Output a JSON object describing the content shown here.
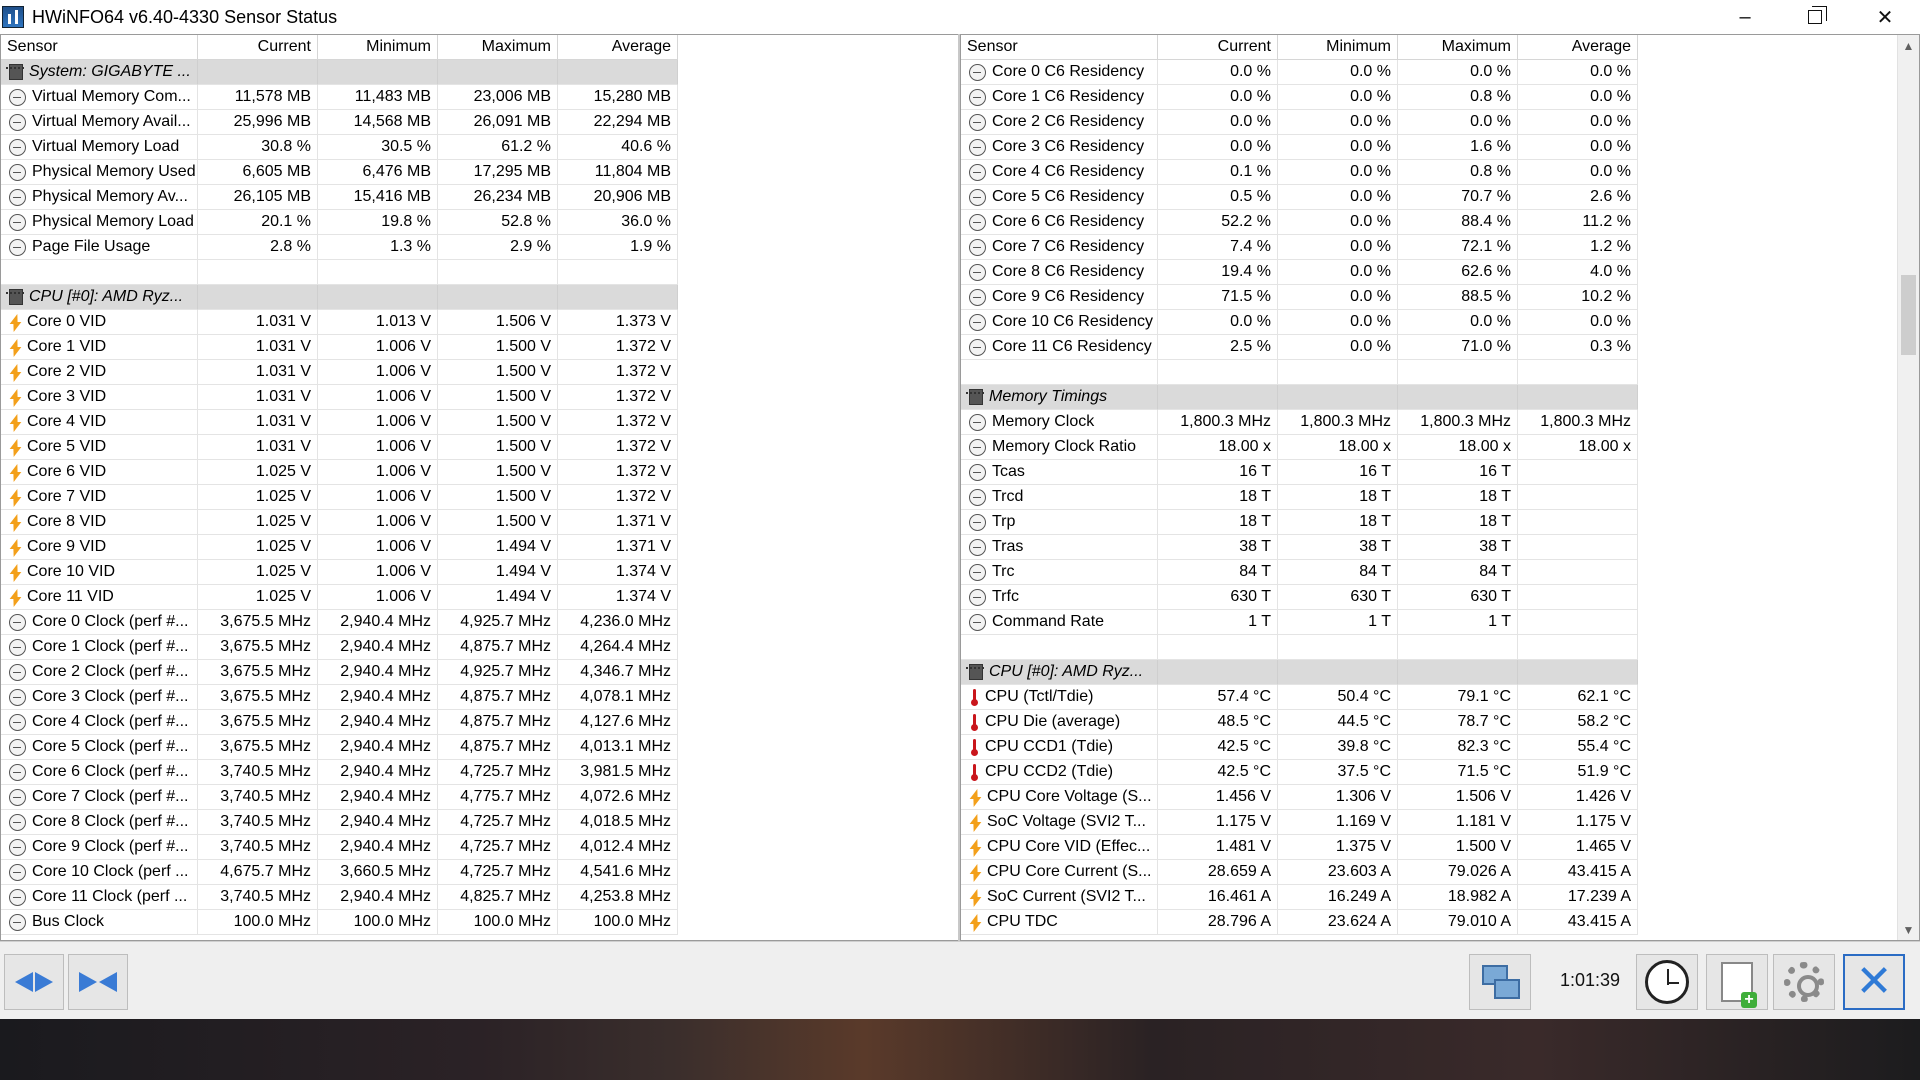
{
  "window": {
    "title": "HWiNFO64 v6.40-4330 Sensor Status",
    "controls": {
      "minimize": "–",
      "close": "✕"
    }
  },
  "columns": [
    "Sensor",
    "Current",
    "Minimum",
    "Maximum",
    "Average"
  ],
  "left_rows": [
    {
      "type": "group",
      "name": "System: GIGABYTE ..."
    },
    {
      "icon": "clock",
      "name": "Virtual Memory Com...",
      "current": "11,578 MB",
      "minimum": "11,483 MB",
      "maximum": "23,006 MB",
      "average": "15,280 MB"
    },
    {
      "icon": "clock",
      "name": "Virtual Memory Avail...",
      "current": "25,996 MB",
      "minimum": "14,568 MB",
      "maximum": "26,091 MB",
      "average": "22,294 MB"
    },
    {
      "icon": "clock",
      "name": "Virtual Memory Load",
      "current": "30.8 %",
      "minimum": "30.5 %",
      "maximum": "61.2 %",
      "average": "40.6 %"
    },
    {
      "icon": "clock",
      "name": "Physical Memory Used",
      "current": "6,605 MB",
      "minimum": "6,476 MB",
      "maximum": "17,295 MB",
      "average": "11,804 MB"
    },
    {
      "icon": "clock",
      "name": "Physical Memory Av...",
      "current": "26,105 MB",
      "minimum": "15,416 MB",
      "maximum": "26,234 MB",
      "average": "20,906 MB"
    },
    {
      "icon": "clock",
      "name": "Physical Memory Load",
      "current": "20.1 %",
      "minimum": "19.8 %",
      "maximum": "52.8 %",
      "average": "36.0 %"
    },
    {
      "icon": "clock",
      "name": "Page File Usage",
      "current": "2.8 %",
      "minimum": "1.3 %",
      "maximum": "2.9 %",
      "average": "1.9 %"
    },
    {
      "type": "blank"
    },
    {
      "type": "group",
      "name": "CPU [#0]: AMD Ryz..."
    },
    {
      "icon": "volt",
      "name": "Core 0 VID",
      "current": "1.031 V",
      "minimum": "1.013 V",
      "maximum": "1.506 V",
      "average": "1.373 V"
    },
    {
      "icon": "volt",
      "name": "Core 1 VID",
      "current": "1.031 V",
      "minimum": "1.006 V",
      "maximum": "1.500 V",
      "average": "1.372 V"
    },
    {
      "icon": "volt",
      "name": "Core 2 VID",
      "current": "1.031 V",
      "minimum": "1.006 V",
      "maximum": "1.500 V",
      "average": "1.372 V"
    },
    {
      "icon": "volt",
      "name": "Core 3 VID",
      "current": "1.031 V",
      "minimum": "1.006 V",
      "maximum": "1.500 V",
      "average": "1.372 V"
    },
    {
      "icon": "volt",
      "name": "Core 4 VID",
      "current": "1.031 V",
      "minimum": "1.006 V",
      "maximum": "1.500 V",
      "average": "1.372 V"
    },
    {
      "icon": "volt",
      "name": "Core 5 VID",
      "current": "1.031 V",
      "minimum": "1.006 V",
      "maximum": "1.500 V",
      "average": "1.372 V"
    },
    {
      "icon": "volt",
      "name": "Core 6 VID",
      "current": "1.025 V",
      "minimum": "1.006 V",
      "maximum": "1.500 V",
      "average": "1.372 V"
    },
    {
      "icon": "volt",
      "name": "Core 7 VID",
      "current": "1.025 V",
      "minimum": "1.006 V",
      "maximum": "1.500 V",
      "average": "1.372 V"
    },
    {
      "icon": "volt",
      "name": "Core 8 VID",
      "current": "1.025 V",
      "minimum": "1.006 V",
      "maximum": "1.500 V",
      "average": "1.371 V"
    },
    {
      "icon": "volt",
      "name": "Core 9 VID",
      "current": "1.025 V",
      "minimum": "1.006 V",
      "maximum": "1.494 V",
      "average": "1.371 V"
    },
    {
      "icon": "volt",
      "name": "Core 10 VID",
      "current": "1.025 V",
      "minimum": "1.006 V",
      "maximum": "1.494 V",
      "average": "1.374 V"
    },
    {
      "icon": "volt",
      "name": "Core 11 VID",
      "current": "1.025 V",
      "minimum": "1.006 V",
      "maximum": "1.494 V",
      "average": "1.374 V"
    },
    {
      "icon": "clock",
      "name": "Core 0 Clock (perf #...",
      "current": "3,675.5 MHz",
      "minimum": "2,940.4 MHz",
      "maximum": "4,925.7 MHz",
      "average": "4,236.0 MHz"
    },
    {
      "icon": "clock",
      "name": "Core 1 Clock (perf #...",
      "current": "3,675.5 MHz",
      "minimum": "2,940.4 MHz",
      "maximum": "4,875.7 MHz",
      "average": "4,264.4 MHz"
    },
    {
      "icon": "clock",
      "name": "Core 2 Clock (perf #...",
      "current": "3,675.5 MHz",
      "minimum": "2,940.4 MHz",
      "maximum": "4,925.7 MHz",
      "average": "4,346.7 MHz"
    },
    {
      "icon": "clock",
      "name": "Core 3 Clock (perf #...",
      "current": "3,675.5 MHz",
      "minimum": "2,940.4 MHz",
      "maximum": "4,875.7 MHz",
      "average": "4,078.1 MHz"
    },
    {
      "icon": "clock",
      "name": "Core 4 Clock (perf #...",
      "current": "3,675.5 MHz",
      "minimum": "2,940.4 MHz",
      "maximum": "4,875.7 MHz",
      "average": "4,127.6 MHz"
    },
    {
      "icon": "clock",
      "name": "Core 5 Clock (perf #...",
      "current": "3,675.5 MHz",
      "minimum": "2,940.4 MHz",
      "maximum": "4,875.7 MHz",
      "average": "4,013.1 MHz"
    },
    {
      "icon": "clock",
      "name": "Core 6 Clock (perf #...",
      "current": "3,740.5 MHz",
      "minimum": "2,940.4 MHz",
      "maximum": "4,725.7 MHz",
      "average": "3,981.5 MHz"
    },
    {
      "icon": "clock",
      "name": "Core 7 Clock (perf #...",
      "current": "3,740.5 MHz",
      "minimum": "2,940.4 MHz",
      "maximum": "4,775.7 MHz",
      "average": "4,072.6 MHz"
    },
    {
      "icon": "clock",
      "name": "Core 8 Clock (perf #...",
      "current": "3,740.5 MHz",
      "minimum": "2,940.4 MHz",
      "maximum": "4,725.7 MHz",
      "average": "4,018.5 MHz"
    },
    {
      "icon": "clock",
      "name": "Core 9 Clock (perf #...",
      "current": "3,740.5 MHz",
      "minimum": "2,940.4 MHz",
      "maximum": "4,725.7 MHz",
      "average": "4,012.4 MHz"
    },
    {
      "icon": "clock",
      "name": "Core 10 Clock (perf ...",
      "current": "4,675.7 MHz",
      "minimum": "3,660.5 MHz",
      "maximum": "4,725.7 MHz",
      "average": "4,541.6 MHz"
    },
    {
      "icon": "clock",
      "name": "Core 11 Clock (perf ...",
      "current": "3,740.5 MHz",
      "minimum": "2,940.4 MHz",
      "maximum": "4,825.7 MHz",
      "average": "4,253.8 MHz"
    },
    {
      "icon": "clock",
      "name": "Bus Clock",
      "current": "100.0 MHz",
      "minimum": "100.0 MHz",
      "maximum": "100.0 MHz",
      "average": "100.0 MHz"
    }
  ],
  "right_rows": [
    {
      "icon": "clock",
      "name": "Core 0 C6 Residency",
      "current": "0.0 %",
      "minimum": "0.0 %",
      "maximum": "0.0 %",
      "average": "0.0 %"
    },
    {
      "icon": "clock",
      "name": "Core 1 C6 Residency",
      "current": "0.0 %",
      "minimum": "0.0 %",
      "maximum": "0.8 %",
      "average": "0.0 %"
    },
    {
      "icon": "clock",
      "name": "Core 2 C6 Residency",
      "current": "0.0 %",
      "minimum": "0.0 %",
      "maximum": "0.0 %",
      "average": "0.0 %"
    },
    {
      "icon": "clock",
      "name": "Core 3 C6 Residency",
      "current": "0.0 %",
      "minimum": "0.0 %",
      "maximum": "1.6 %",
      "average": "0.0 %"
    },
    {
      "icon": "clock",
      "name": "Core 4 C6 Residency",
      "current": "0.1 %",
      "minimum": "0.0 %",
      "maximum": "0.8 %",
      "average": "0.0 %"
    },
    {
      "icon": "clock",
      "name": "Core 5 C6 Residency",
      "current": "0.5 %",
      "minimum": "0.0 %",
      "maximum": "70.7 %",
      "average": "2.6 %"
    },
    {
      "icon": "clock",
      "name": "Core 6 C6 Residency",
      "current": "52.2 %",
      "minimum": "0.0 %",
      "maximum": "88.4 %",
      "average": "11.2 %"
    },
    {
      "icon": "clock",
      "name": "Core 7 C6 Residency",
      "current": "7.4 %",
      "minimum": "0.0 %",
      "maximum": "72.1 %",
      "average": "1.2 %"
    },
    {
      "icon": "clock",
      "name": "Core 8 C6 Residency",
      "current": "19.4 %",
      "minimum": "0.0 %",
      "maximum": "62.6 %",
      "average": "4.0 %"
    },
    {
      "icon": "clock",
      "name": "Core 9 C6 Residency",
      "current": "71.5 %",
      "minimum": "0.0 %",
      "maximum": "88.5 %",
      "average": "10.2 %"
    },
    {
      "icon": "clock",
      "name": "Core 10 C6 Residency",
      "current": "0.0 %",
      "minimum": "0.0 %",
      "maximum": "0.0 %",
      "average": "0.0 %"
    },
    {
      "icon": "clock",
      "name": "Core 11 C6 Residency",
      "current": "2.5 %",
      "minimum": "0.0 %",
      "maximum": "71.0 %",
      "average": "0.3 %"
    },
    {
      "type": "blank"
    },
    {
      "type": "group",
      "name": "Memory Timings"
    },
    {
      "icon": "clock",
      "name": "Memory Clock",
      "current": "1,800.3 MHz",
      "minimum": "1,800.3 MHz",
      "maximum": "1,800.3 MHz",
      "average": "1,800.3 MHz"
    },
    {
      "icon": "clock",
      "name": "Memory Clock Ratio",
      "current": "18.00 x",
      "minimum": "18.00 x",
      "maximum": "18.00 x",
      "average": "18.00 x"
    },
    {
      "icon": "clock",
      "name": "Tcas",
      "current": "16 T",
      "minimum": "16 T",
      "maximum": "16 T",
      "average": ""
    },
    {
      "icon": "clock",
      "name": "Trcd",
      "current": "18 T",
      "minimum": "18 T",
      "maximum": "18 T",
      "average": ""
    },
    {
      "icon": "clock",
      "name": "Trp",
      "current": "18 T",
      "minimum": "18 T",
      "maximum": "18 T",
      "average": ""
    },
    {
      "icon": "clock",
      "name": "Tras",
      "current": "38 T",
      "minimum": "38 T",
      "maximum": "38 T",
      "average": ""
    },
    {
      "icon": "clock",
      "name": "Trc",
      "current": "84 T",
      "minimum": "84 T",
      "maximum": "84 T",
      "average": ""
    },
    {
      "icon": "clock",
      "name": "Trfc",
      "current": "630 T",
      "minimum": "630 T",
      "maximum": "630 T",
      "average": ""
    },
    {
      "icon": "clock",
      "name": "Command Rate",
      "current": "1 T",
      "minimum": "1 T",
      "maximum": "1 T",
      "average": ""
    },
    {
      "type": "blank"
    },
    {
      "type": "group",
      "name": "CPU [#0]: AMD Ryz..."
    },
    {
      "icon": "temp",
      "name": "CPU (Tctl/Tdie)",
      "current": "57.4 °C",
      "minimum": "50.4 °C",
      "maximum": "79.1 °C",
      "average": "62.1 °C"
    },
    {
      "icon": "temp",
      "name": "CPU Die (average)",
      "current": "48.5 °C",
      "minimum": "44.5 °C",
      "maximum": "78.7 °C",
      "average": "58.2 °C"
    },
    {
      "icon": "temp",
      "name": "CPU CCD1 (Tdie)",
      "current": "42.5 °C",
      "minimum": "39.8 °C",
      "maximum": "82.3 °C",
      "average": "55.4 °C"
    },
    {
      "icon": "temp",
      "name": "CPU CCD2 (Tdie)",
      "current": "42.5 °C",
      "minimum": "37.5 °C",
      "maximum": "71.5 °C",
      "average": "51.9 °C"
    },
    {
      "icon": "volt",
      "name": "CPU Core Voltage (S...",
      "current": "1.456 V",
      "minimum": "1.306 V",
      "maximum": "1.506 V",
      "average": "1.426 V"
    },
    {
      "icon": "volt",
      "name": "SoC Voltage (SVI2 T...",
      "current": "1.175 V",
      "minimum": "1.169 V",
      "maximum": "1.181 V",
      "average": "1.175 V"
    },
    {
      "icon": "volt",
      "name": "CPU Core VID (Effec...",
      "current": "1.481 V",
      "minimum": "1.375 V",
      "maximum": "1.500 V",
      "average": "1.465 V"
    },
    {
      "icon": "volt",
      "name": "CPU Core Current (S...",
      "current": "28.659 A",
      "minimum": "23.603 A",
      "maximum": "79.026 A",
      "average": "43.415 A"
    },
    {
      "icon": "volt",
      "name": "SoC Current (SVI2 T...",
      "current": "16.461 A",
      "minimum": "16.249 A",
      "maximum": "18.982 A",
      "average": "17.239 A"
    },
    {
      "icon": "volt",
      "name": "CPU TDC",
      "current": "28.796 A",
      "minimum": "23.624 A",
      "maximum": "79.010 A",
      "average": "43.415 A"
    }
  ],
  "toolbar": {
    "elapsed_time": "1:01:39"
  },
  "scrollbar": {
    "up": "▲",
    "down": "▼"
  },
  "colors": {
    "group_row": "#dadada",
    "accent": "#2f7ad6",
    "volt_icon": "#f3a01a",
    "temp_icon": "#c9161c"
  }
}
